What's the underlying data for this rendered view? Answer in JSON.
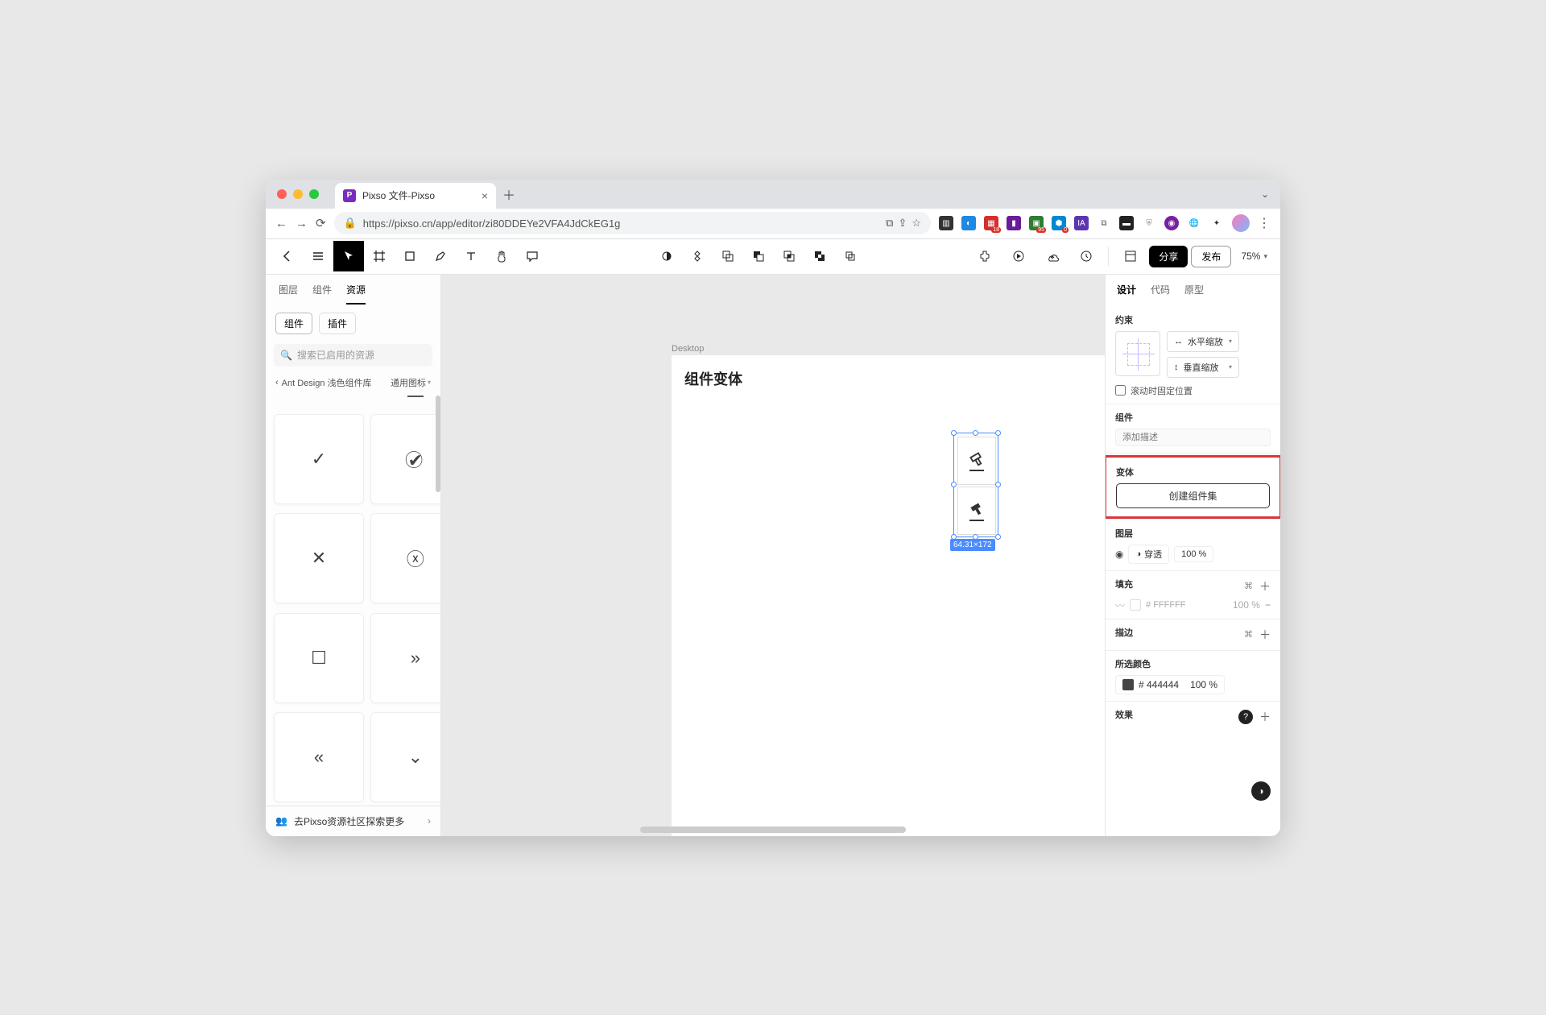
{
  "browser": {
    "tab_title": "Pixso 文件-Pixso",
    "url": "https://pixso.cn/app/editor/zi80DDEYe2VFA4JdCkEG1g"
  },
  "toolbar": {
    "share": "分享",
    "publish": "发布",
    "zoom": "75%"
  },
  "left_panel": {
    "tabs": {
      "layers": "图层",
      "components": "组件",
      "assets": "资源"
    },
    "subtabs": {
      "components": "组件",
      "plugins": "插件"
    },
    "search_placeholder": "搜索已启用的资源",
    "breadcrumb_lib": "Ant Design 浅色组件库",
    "breadcrumb_cat": "通用图标",
    "footer": "去Pixso资源社区探索更多"
  },
  "canvas": {
    "frame_label": "Desktop",
    "frame_title": "组件变体",
    "dims": "64.31×172"
  },
  "right_panel": {
    "tabs": {
      "design": "设计",
      "code": "代码",
      "prototype": "原型"
    },
    "constraints": {
      "title": "约束",
      "h": "水平缩放",
      "v": "垂直缩放",
      "fix_scroll": "滚动时固定位置"
    },
    "component": {
      "title": "组件",
      "desc_placeholder": "添加描述"
    },
    "variant": {
      "title": "变体",
      "create_btn": "创建组件集"
    },
    "layer": {
      "title": "图层",
      "blend": "穿透",
      "opacity": "100 %"
    },
    "fill": {
      "title": "填充",
      "hex": "# FFFFFF",
      "opacity": "100 %"
    },
    "stroke": {
      "title": "描边"
    },
    "selected_color": {
      "title": "所选颜色",
      "hex": "# 444444",
      "opacity": "100 %"
    },
    "effects": {
      "title": "效果"
    }
  }
}
